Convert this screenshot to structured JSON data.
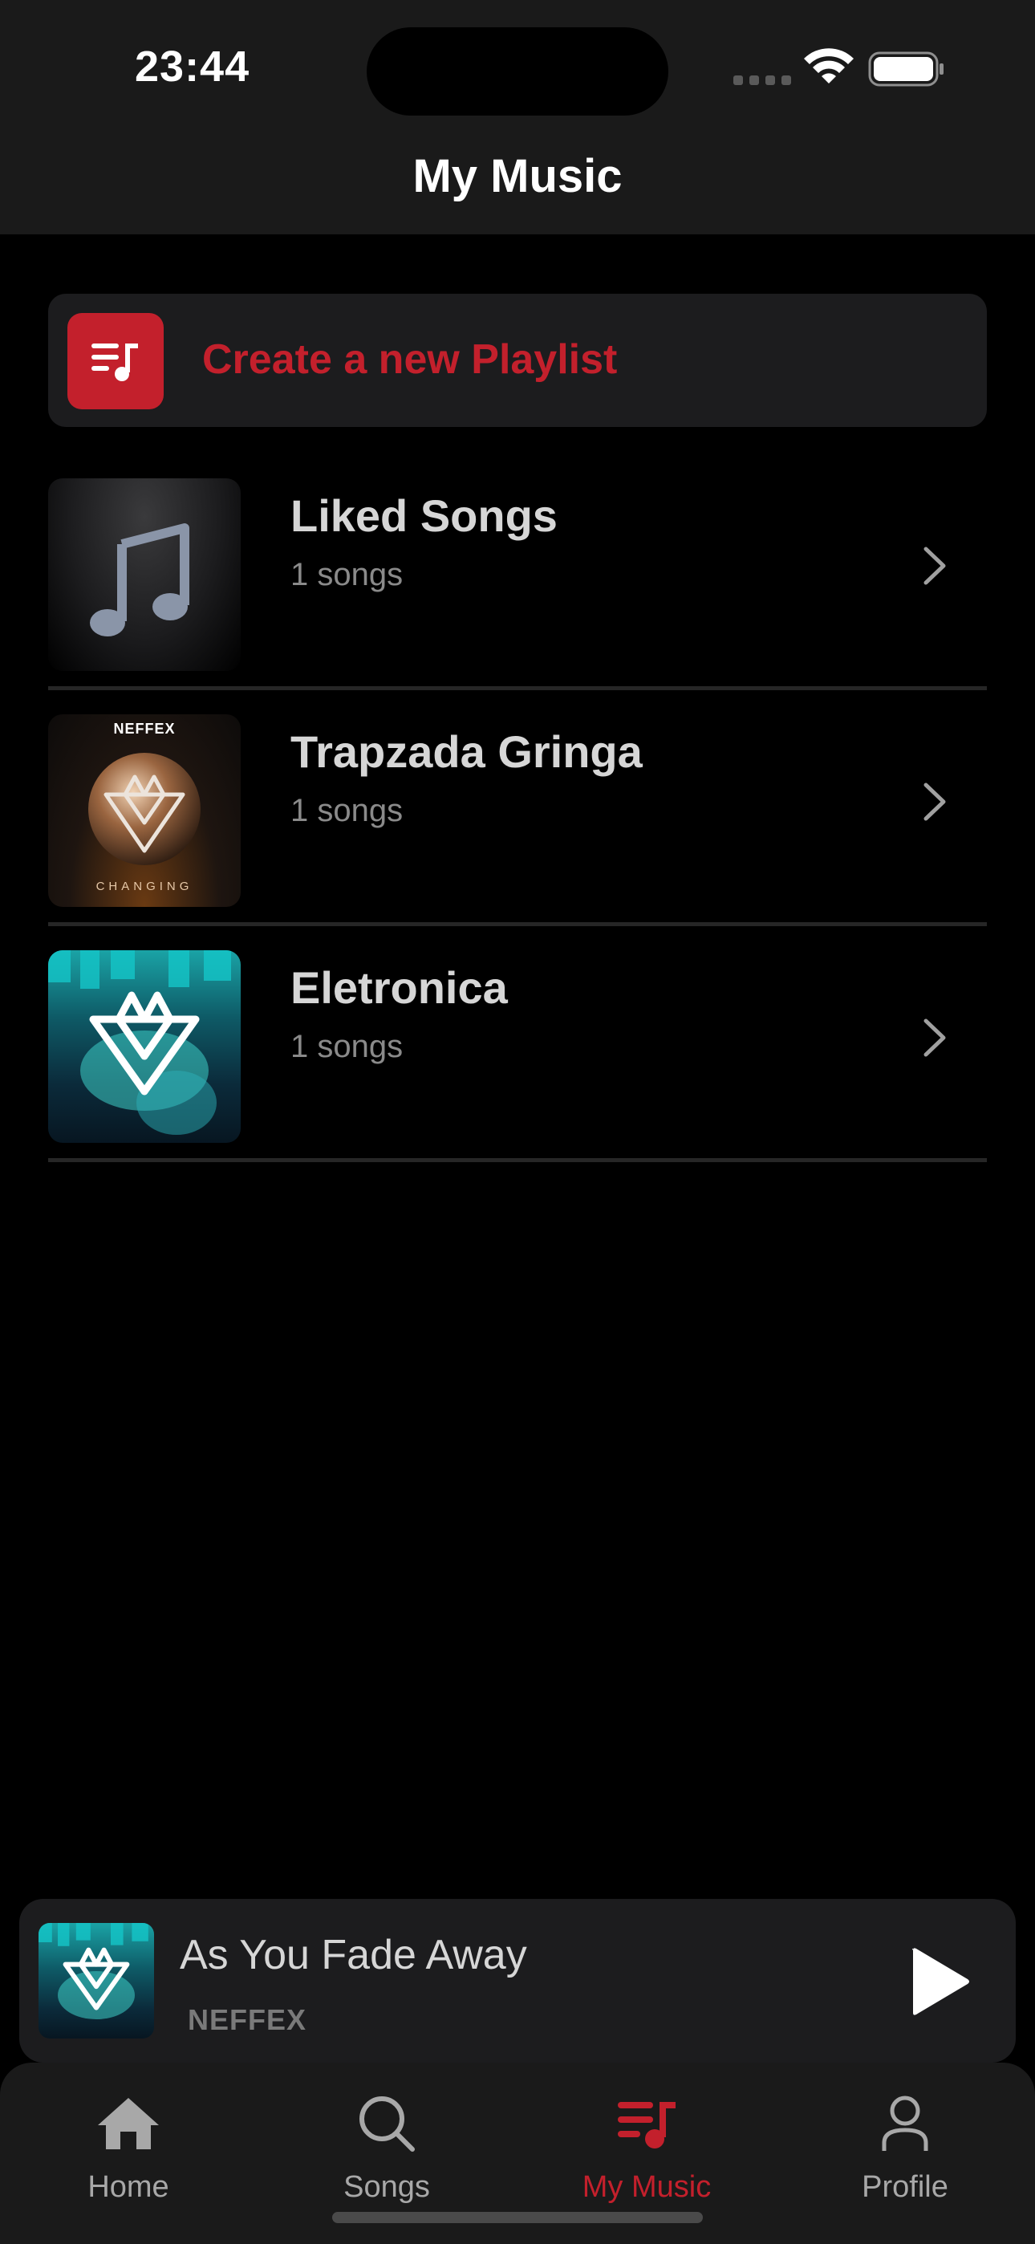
{
  "status_bar": {
    "time": "23:44"
  },
  "header": {
    "title": "My Music"
  },
  "create_playlist": {
    "label": "Create a new Playlist"
  },
  "playlists": [
    {
      "name": "Liked Songs",
      "count": "1 songs",
      "art": "music-note-art"
    },
    {
      "name": "Trapzada Gringa",
      "count": "1 songs",
      "art": "changing-album-art",
      "art_text_top": "NEFFEX",
      "art_text_bottom": "CHANGING"
    },
    {
      "name": "Eletronica",
      "count": "1 songs",
      "art": "you-fade-away-album-art"
    }
  ],
  "now_playing": {
    "title": "As You Fade Away",
    "artist": "NEFFEX"
  },
  "tabs": [
    {
      "label": "Home",
      "icon": "house-icon",
      "active": false
    },
    {
      "label": "Songs",
      "icon": "search-icon",
      "active": false
    },
    {
      "label": "My Music",
      "icon": "playlist-music-icon",
      "active": true
    },
    {
      "label": "Profile",
      "icon": "person-icon",
      "active": false
    }
  ],
  "colors": {
    "accent": "#c3202c",
    "background": "#000000",
    "surface": "#1c1c1e",
    "header": "#1a1a1a"
  }
}
